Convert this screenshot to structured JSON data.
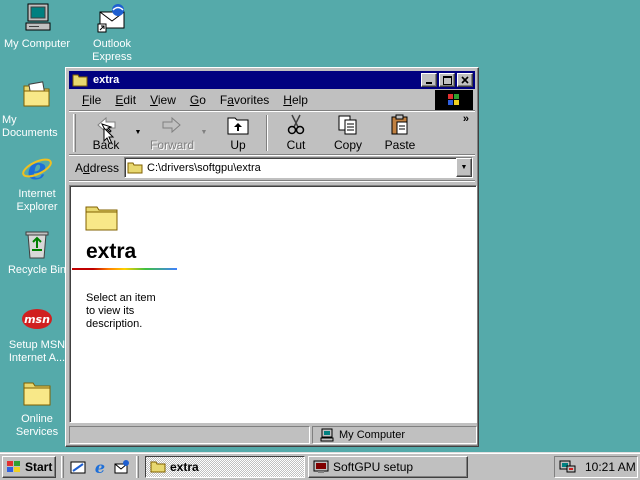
{
  "desktop": {
    "icons": [
      {
        "label": "My Computer",
        "icon": "my-computer-icon"
      },
      {
        "label": "Outlook\nExpress",
        "icon": "outlook-express-icon"
      },
      {
        "label": "My Documents",
        "icon": "folder-documents-icon"
      },
      {
        "label": "Internet\nExplorer",
        "icon": "internet-explorer-icon"
      },
      {
        "label": "Recycle Bin",
        "icon": "recycle-bin-icon"
      },
      {
        "label": "Setup MSN\nInternet A...",
        "icon": "msn-icon"
      },
      {
        "label": "Online\nServices",
        "icon": "folder-icon"
      }
    ],
    "background": "#55aaaa"
  },
  "window": {
    "title": "extra",
    "buttons": {
      "minimize": "minimize",
      "maximize": "maximize",
      "close": "close"
    },
    "menu": [
      "File",
      "Edit",
      "View",
      "Go",
      "Favorites",
      "Help"
    ],
    "menu_accel": [
      "F",
      "E",
      "V",
      "G",
      "a",
      "H"
    ],
    "toolbar": {
      "back": "Back",
      "forward": "Forward",
      "up": "Up",
      "cut": "Cut",
      "copy": "Copy",
      "paste": "Paste",
      "more": "»"
    },
    "address": {
      "label": "Address",
      "value": "C:\\drivers\\softgpu\\extra"
    },
    "content": {
      "folder_title": "extra",
      "description": "Select an item to view its description."
    },
    "status": {
      "location": "My Computer"
    },
    "titlebar_color": "#000080"
  },
  "taskbar": {
    "start": "Start",
    "quick_launch": [
      "desktop-icon",
      "internet-explorer-icon",
      "outlook-express-icon"
    ],
    "tasks": [
      {
        "label": "extra",
        "active": true
      },
      {
        "label": "SoftGPU setup",
        "active": false
      }
    ],
    "clock": "10:21 AM"
  }
}
